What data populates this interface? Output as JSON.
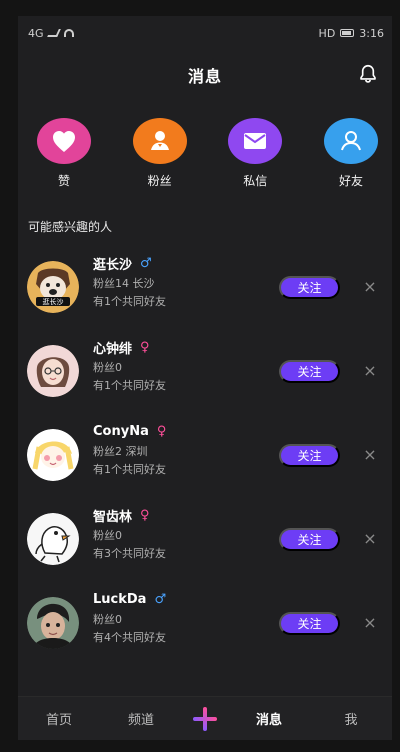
{
  "status_bar": {
    "left_text": "4G",
    "right_text": "HD",
    "time": "3:16"
  },
  "header": {
    "title": "消息"
  },
  "quick_actions": [
    {
      "label": "赞",
      "icon": "heart-icon",
      "color": "#e2449a"
    },
    {
      "label": "粉丝",
      "icon": "user-group-icon",
      "color": "#f27b1d"
    },
    {
      "label": "私信",
      "icon": "mail-icon",
      "color": "#8f48f0"
    },
    {
      "label": "好友",
      "icon": "friend-icon",
      "color": "#37a0ed"
    }
  ],
  "section": {
    "title": "可能感兴趣的人"
  },
  "users": [
    {
      "name": "逛长沙",
      "gender": "♂",
      "gender_color": "#4aa3ff",
      "meta": "粉丝14  长沙",
      "mutual": "有1个共同好友",
      "follow_label": "关注"
    },
    {
      "name": "心钟绯",
      "gender": "♀",
      "gender_color": "#ff4f9a",
      "meta": "粉丝0",
      "mutual": "有1个共同好友",
      "follow_label": "关注"
    },
    {
      "name": "ConyNa",
      "gender": "♀",
      "gender_color": "#ff4f9a",
      "meta": "粉丝2  深圳",
      "mutual": "有1个共同好友",
      "follow_label": "关注"
    },
    {
      "name": "智齿林",
      "gender": "♀",
      "gender_color": "#ff4f9a",
      "meta": "粉丝0",
      "mutual": "有3个共同好友",
      "follow_label": "关注"
    },
    {
      "name": "LuckDa",
      "gender": "♂",
      "gender_color": "#4aa3ff",
      "meta": "粉丝0",
      "mutual": "有4个共同好友",
      "follow_label": "关注"
    }
  ],
  "bottom_nav": {
    "home": "首页",
    "channel": "频道",
    "messages": "消息",
    "me": "我"
  },
  "colors": {
    "background": "#1f1f21",
    "follow_button": "#6d3df5"
  }
}
